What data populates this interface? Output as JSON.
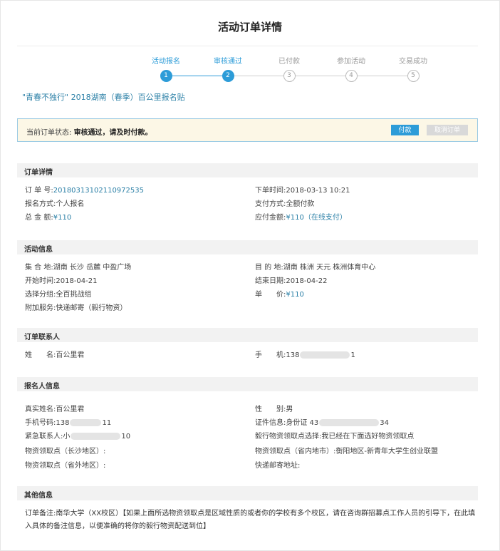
{
  "page": {
    "title": "活动订单详情"
  },
  "steps": [
    {
      "label": "活动报名",
      "num": "1",
      "active": true
    },
    {
      "label": "审核通过",
      "num": "2",
      "active": true
    },
    {
      "label": "已付款",
      "num": "3",
      "active": false
    },
    {
      "label": "参加活动",
      "num": "4",
      "active": false
    },
    {
      "label": "交易成功",
      "num": "5",
      "active": false
    }
  ],
  "event_title": "\"青春不独行\" 2018湖南（春季）百公里报名贴",
  "status": {
    "label": "当前订单状态:",
    "value": "审核通过，请及时付款。",
    "pay_button": "付款",
    "cancel_button": "取消订单"
  },
  "order": {
    "heading": "订单详情",
    "no_label": "订 单 号:",
    "no_value": "20180313102110972535",
    "time_label": "下单时间:",
    "time_value": "2018-03-13 10:21",
    "reg_label": "报名方式:",
    "reg_value": "个人报名",
    "paymode_label": "支付方式:",
    "paymode_value": "全额付款",
    "total_label": "总 金 额:",
    "total_value": "¥110",
    "due_label": "应付金额:",
    "due_value": "¥110（在线支付）"
  },
  "activity": {
    "heading": "活动信息",
    "meet_label": "集 合 地:",
    "meet_value": "湖南 长沙 岳麓 中盈广场",
    "dest_label": "目 的 地:",
    "dest_value": "湖南 株洲 天元 株洲体育中心",
    "start_label": "开始时间:",
    "start_value": "2018-04-21",
    "end_label": "结束日期:",
    "end_value": "2018-04-22",
    "group_label": "选择分组:",
    "group_value": "全百挑战组",
    "price_label": "单　　价:",
    "price_value": "¥110",
    "extra_label": "附加服务:",
    "extra_value": "快递邮寄（毅行物资）"
  },
  "contact": {
    "heading": "订单联系人",
    "name_label": "姓　　名:",
    "name_value": "百公里君",
    "phone_label": "手　　机:",
    "phone_prefix": "138",
    "phone_suffix": "1"
  },
  "registrant": {
    "heading": "报名人信息",
    "realname_label": "真实姓名:",
    "realname_value": "百公里君",
    "gender_label": "性　　别:",
    "gender_value": "男",
    "mobile_label": "手机号码:",
    "mobile_prefix": "138",
    "mobile_suffix": "11",
    "id_label": "证件信息:",
    "id_prefix": "身份证 43",
    "id_suffix": "34",
    "emergency_label": "紧急联系人:",
    "emergency_prefix": "小",
    "emergency_suffix": "10",
    "pickup_choice_label": "毅行物资领取点选择:",
    "pickup_choice_value": "我已经在下面选好物资领取点",
    "pickup_cs_label": "物资领取点（长沙地区）:",
    "pickup_cs_value": "",
    "pickup_prov_label": "物资领取点（省内地市）:",
    "pickup_prov_value": "衡阳地区-新青年大学生创业联盟",
    "pickup_out_label": "物资领取点（省外地区）:",
    "pickup_out_value": "",
    "post_label": "快递邮寄地址:",
    "post_value": ""
  },
  "other": {
    "heading": "其他信息",
    "note_label": "订单备注:",
    "note_value": "南华大学（XX校区）【如果上面所选物资领取点是区域性质的或者你的学校有多个校区，请在咨询群招募点工作人员的引导下，在此填入具体的备注信息，以便准确的将你的毅行物资配送到位】"
  }
}
